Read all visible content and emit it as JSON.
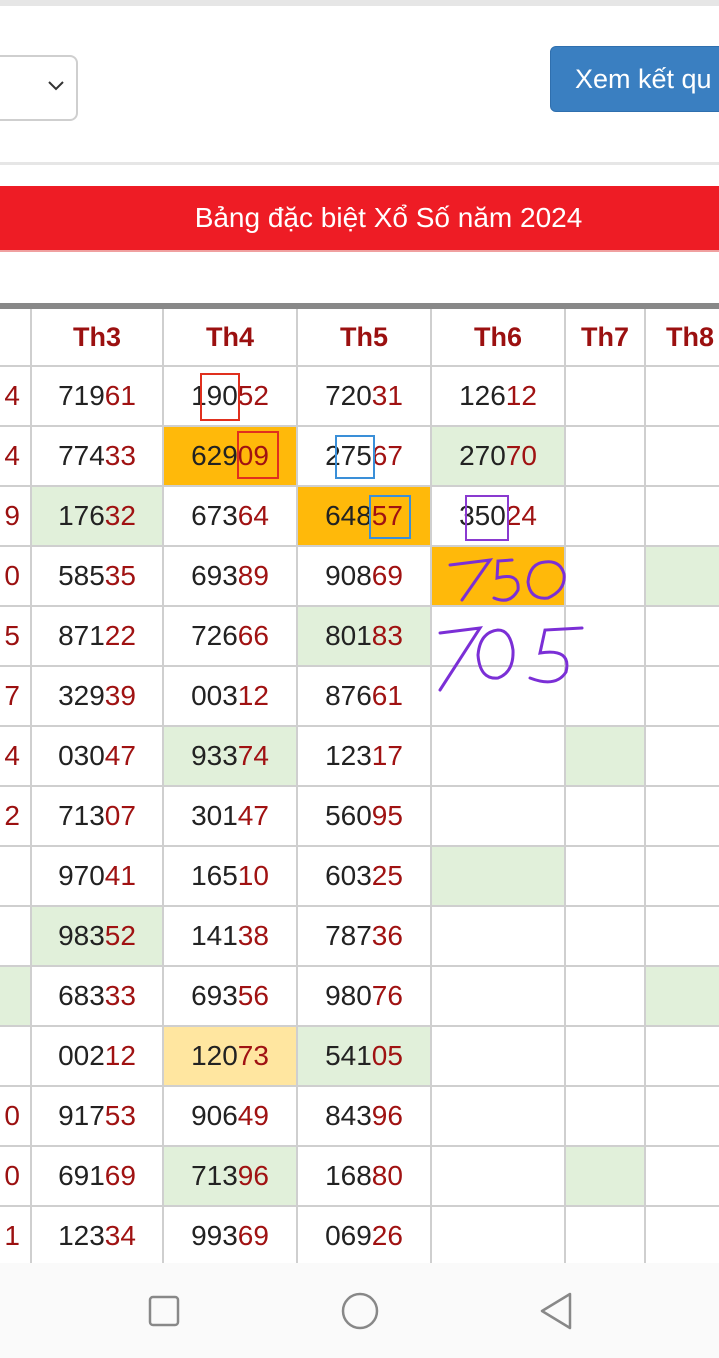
{
  "header": {
    "view_button_label": "Xem kết qu",
    "select_value": ""
  },
  "banner": {
    "title": "Bảng đặc biệt Xổ Số năm 2024"
  },
  "table": {
    "columns": [
      "",
      "Th3",
      "Th4",
      "Th5",
      "Th6",
      "Th7",
      "Th8"
    ],
    "rows": [
      {
        "c0": "4",
        "c1": [
          "719",
          "61"
        ],
        "c2": [
          "190",
          "52"
        ],
        "c3": [
          "720",
          "31"
        ],
        "c4": [
          "126",
          "12"
        ],
        "bg": {}
      },
      {
        "c0": "4",
        "c1": [
          "774",
          "33"
        ],
        "c2": [
          "629",
          "09"
        ],
        "c3": [
          "275",
          "67"
        ],
        "c4": [
          "270",
          "70"
        ],
        "bg": {
          "c2": "orange",
          "c4": "green"
        }
      },
      {
        "c0": "9",
        "c1": [
          "176",
          "32"
        ],
        "c2": [
          "673",
          "64"
        ],
        "c3": [
          "648",
          "57"
        ],
        "c4": [
          "350",
          "24"
        ],
        "bg": {
          "c1": "green",
          "c3": "orange"
        }
      },
      {
        "c0": "0",
        "c1": [
          "585",
          "35"
        ],
        "c2": [
          "693",
          "89"
        ],
        "c3": [
          "908",
          "69"
        ],
        "c4": [
          "",
          ""
        ],
        "bg": {
          "c4": "orange",
          "c6": "green"
        }
      },
      {
        "c0": "5",
        "c1": [
          "871",
          "22"
        ],
        "c2": [
          "726",
          "66"
        ],
        "c3": [
          "801",
          "83"
        ],
        "c4": [
          "",
          ""
        ],
        "bg": {
          "c3": "green"
        }
      },
      {
        "c0": "7",
        "c1": [
          "329",
          "39"
        ],
        "c2": [
          "003",
          "12"
        ],
        "c3": [
          "876",
          "61"
        ],
        "c4": [
          "",
          ""
        ],
        "bg": {}
      },
      {
        "c0": "4",
        "c1": [
          "030",
          "47"
        ],
        "c2": [
          "933",
          "74"
        ],
        "c3": [
          "123",
          "17"
        ],
        "c4": [
          "",
          ""
        ],
        "bg": {
          "c2": "green",
          "c5": "green"
        }
      },
      {
        "c0": "2",
        "c1": [
          "713",
          "07"
        ],
        "c2": [
          "301",
          "47"
        ],
        "c3": [
          "560",
          "95"
        ],
        "c4": [
          "",
          ""
        ],
        "bg": {}
      },
      {
        "c0": "",
        "c1": [
          "970",
          "41"
        ],
        "c2": [
          "165",
          "10"
        ],
        "c3": [
          "603",
          "25"
        ],
        "c4": [
          "",
          ""
        ],
        "bg": {
          "c4": "green"
        }
      },
      {
        "c0": "",
        "c1": [
          "983",
          "52"
        ],
        "c2": [
          "141",
          "38"
        ],
        "c3": [
          "787",
          "36"
        ],
        "c4": [
          "",
          ""
        ],
        "bg": {
          "c1": "green"
        }
      },
      {
        "c0": "",
        "c1": [
          "683",
          "33"
        ],
        "c2": [
          "693",
          "56"
        ],
        "c3": [
          "980",
          "76"
        ],
        "c4": [
          "",
          ""
        ],
        "bg": {
          "c0": "green",
          "c6": "green"
        }
      },
      {
        "c0": "",
        "c1": [
          "002",
          "12"
        ],
        "c2": [
          "120",
          "73"
        ],
        "c3": [
          "541",
          "05"
        ],
        "c4": [
          "",
          ""
        ],
        "bg": {
          "c2": "yellow",
          "c3": "green"
        }
      },
      {
        "c0": "0",
        "c1": [
          "917",
          "53"
        ],
        "c2": [
          "906",
          "49"
        ],
        "c3": [
          "843",
          "96"
        ],
        "c4": [
          "",
          ""
        ],
        "bg": {}
      },
      {
        "c0": "0",
        "c1": [
          "691",
          "69"
        ],
        "c2": [
          "713",
          "96"
        ],
        "c3": [
          "168",
          "80"
        ],
        "c4": [
          "",
          ""
        ],
        "bg": {
          "c2": "green",
          "c5": "green"
        }
      },
      {
        "c0": "1",
        "c1": [
          "123",
          "34"
        ],
        "c2": [
          "993",
          "69"
        ],
        "c3": [
          "069",
          "26"
        ],
        "c4": [
          "",
          ""
        ],
        "bg": {}
      }
    ]
  },
  "annotations": {
    "handwritten_1": "750",
    "handwritten_2": "705",
    "colors": {
      "red_box": "#e0301e",
      "blue_box": "#3a8fd8",
      "purple_box": "#8a3ad0",
      "handwriting": "#7b2fd6"
    }
  },
  "navbar": {
    "icons": [
      "square-icon",
      "circle-icon",
      "triangle-back-icon"
    ]
  }
}
